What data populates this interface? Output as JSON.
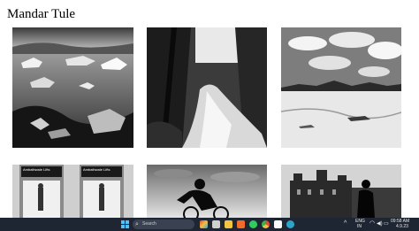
{
  "page": {
    "title": "Mandar Tule"
  },
  "gallery": {
    "photos": [
      {
        "alt": "Icebergs floating on a lagoon"
      },
      {
        "alt": "Waterfall in a forest"
      },
      {
        "alt": "Clouds over a snowy plain"
      },
      {
        "alt": "Elevator doors",
        "signs": [
          "Ambathwale Lifts",
          "Ambathwale Lifts"
        ]
      },
      {
        "alt": "Cyclist silhouette"
      },
      {
        "alt": "Silhouette in front of a castle"
      }
    ]
  },
  "taskbar": {
    "search_placeholder": "Search",
    "lang": "ENG",
    "lang_sub": "IN",
    "time": "09:58 AM",
    "date": "4.9.23",
    "accent": "#4cc2ff"
  }
}
